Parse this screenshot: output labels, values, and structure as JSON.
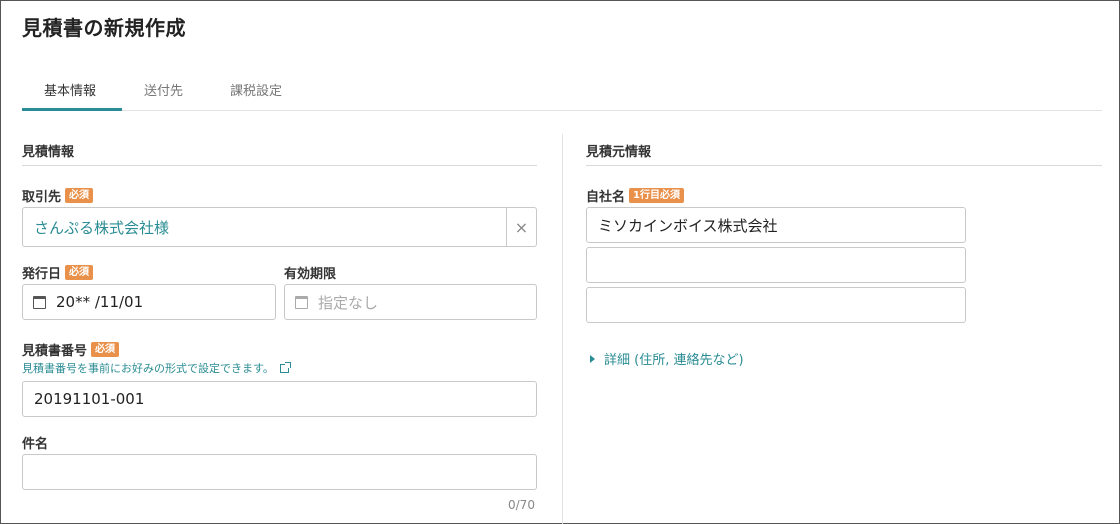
{
  "page": {
    "title": "見積書の新規作成"
  },
  "tabs": [
    {
      "label": "基本情報"
    },
    {
      "label": "送付先"
    },
    {
      "label": "課税設定"
    }
  ],
  "estimate_info": {
    "section_title": "見積情報",
    "client": {
      "label": "取引先",
      "badge": "必須",
      "value": "さんぷる株式会社様",
      "clear": "×"
    },
    "issue_date": {
      "label": "発行日",
      "badge": "必須",
      "value": "20** /11/01"
    },
    "expiry": {
      "label": "有効期限",
      "placeholder": "指定なし"
    },
    "number": {
      "label": "見積書番号",
      "badge": "必須",
      "helper": "見積書番号を事前にお好みの形式で設定できます。",
      "value": "20191101-001"
    },
    "subject": {
      "label": "件名",
      "value": "",
      "counter": "0/70"
    }
  },
  "issuer_info": {
    "section_title": "見積元情報",
    "company": {
      "label": "自社名",
      "badge": "1行目必須",
      "lines": [
        "ミソカインボイス株式会社",
        "",
        ""
      ]
    },
    "details_link": "詳細 (住所, 連絡先など)"
  }
}
